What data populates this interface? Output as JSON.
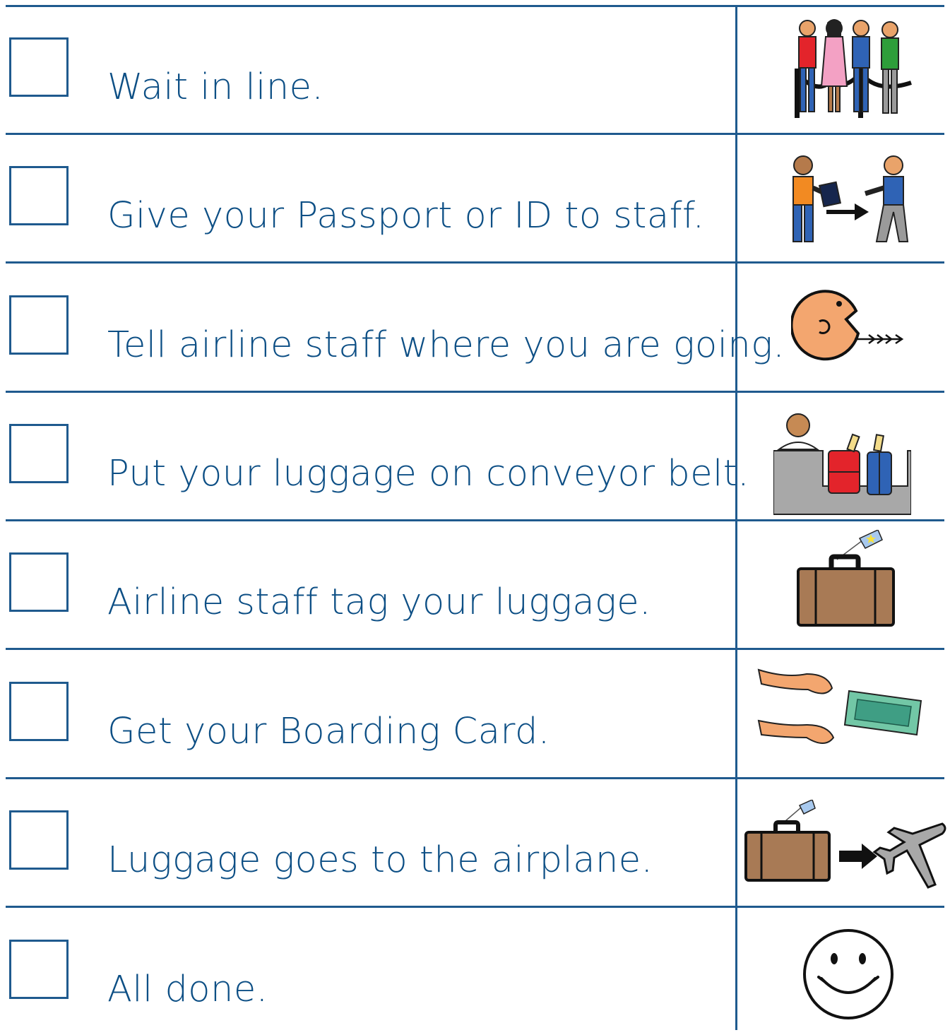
{
  "checklist": {
    "items": [
      {
        "label": "Wait in line.",
        "checked": false,
        "icon": "people-waiting-in-line-icon"
      },
      {
        "label": "Give your Passport or ID to staff.",
        "checked": false,
        "icon": "hand-over-passport-icon"
      },
      {
        "label": "Tell airline staff where you are going.",
        "checked": false,
        "icon": "speaking-face-icon"
      },
      {
        "label": "Put your luggage on conveyor belt.",
        "checked": false,
        "icon": "luggage-on-conveyor-icon"
      },
      {
        "label": "Airline staff tag your luggage.",
        "checked": false,
        "icon": "tagged-suitcase-icon"
      },
      {
        "label": "Get your Boarding Card.",
        "checked": false,
        "icon": "hands-receive-ticket-icon"
      },
      {
        "label": "Luggage goes to the airplane.",
        "checked": false,
        "icon": "suitcase-to-airplane-icon"
      },
      {
        "label": "All done.",
        "checked": false,
        "icon": "smiley-face-icon"
      }
    ]
  },
  "colors": {
    "line": "#1f5a8e",
    "text": "#0d4f85"
  }
}
